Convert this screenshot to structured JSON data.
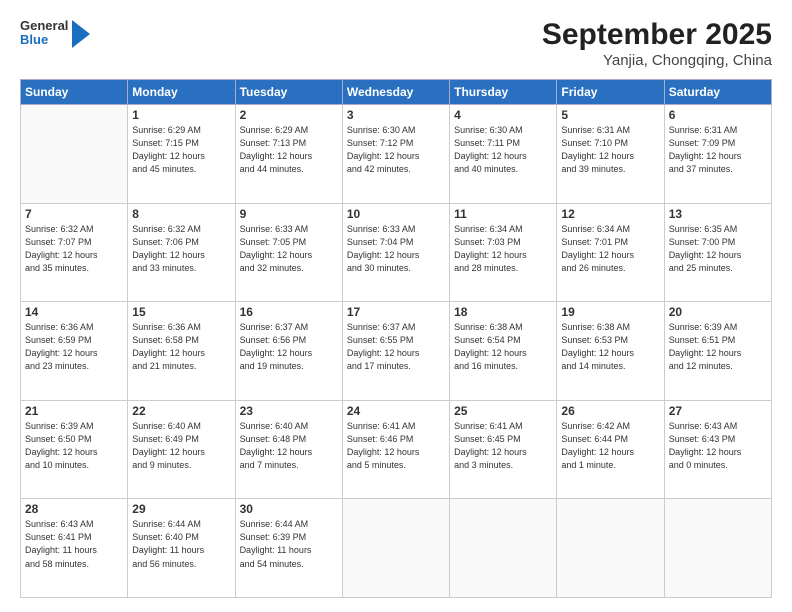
{
  "logo": {
    "general": "General",
    "blue": "Blue"
  },
  "header": {
    "month": "September 2025",
    "location": "Yanjia, Chongqing, China"
  },
  "weekdays": [
    "Sunday",
    "Monday",
    "Tuesday",
    "Wednesday",
    "Thursday",
    "Friday",
    "Saturday"
  ],
  "weeks": [
    [
      {
        "day": "",
        "info": ""
      },
      {
        "day": "1",
        "info": "Sunrise: 6:29 AM\nSunset: 7:15 PM\nDaylight: 12 hours\nand 45 minutes."
      },
      {
        "day": "2",
        "info": "Sunrise: 6:29 AM\nSunset: 7:13 PM\nDaylight: 12 hours\nand 44 minutes."
      },
      {
        "day": "3",
        "info": "Sunrise: 6:30 AM\nSunset: 7:12 PM\nDaylight: 12 hours\nand 42 minutes."
      },
      {
        "day": "4",
        "info": "Sunrise: 6:30 AM\nSunset: 7:11 PM\nDaylight: 12 hours\nand 40 minutes."
      },
      {
        "day": "5",
        "info": "Sunrise: 6:31 AM\nSunset: 7:10 PM\nDaylight: 12 hours\nand 39 minutes."
      },
      {
        "day": "6",
        "info": "Sunrise: 6:31 AM\nSunset: 7:09 PM\nDaylight: 12 hours\nand 37 minutes."
      }
    ],
    [
      {
        "day": "7",
        "info": "Sunrise: 6:32 AM\nSunset: 7:07 PM\nDaylight: 12 hours\nand 35 minutes."
      },
      {
        "day": "8",
        "info": "Sunrise: 6:32 AM\nSunset: 7:06 PM\nDaylight: 12 hours\nand 33 minutes."
      },
      {
        "day": "9",
        "info": "Sunrise: 6:33 AM\nSunset: 7:05 PM\nDaylight: 12 hours\nand 32 minutes."
      },
      {
        "day": "10",
        "info": "Sunrise: 6:33 AM\nSunset: 7:04 PM\nDaylight: 12 hours\nand 30 minutes."
      },
      {
        "day": "11",
        "info": "Sunrise: 6:34 AM\nSunset: 7:03 PM\nDaylight: 12 hours\nand 28 minutes."
      },
      {
        "day": "12",
        "info": "Sunrise: 6:34 AM\nSunset: 7:01 PM\nDaylight: 12 hours\nand 26 minutes."
      },
      {
        "day": "13",
        "info": "Sunrise: 6:35 AM\nSunset: 7:00 PM\nDaylight: 12 hours\nand 25 minutes."
      }
    ],
    [
      {
        "day": "14",
        "info": "Sunrise: 6:36 AM\nSunset: 6:59 PM\nDaylight: 12 hours\nand 23 minutes."
      },
      {
        "day": "15",
        "info": "Sunrise: 6:36 AM\nSunset: 6:58 PM\nDaylight: 12 hours\nand 21 minutes."
      },
      {
        "day": "16",
        "info": "Sunrise: 6:37 AM\nSunset: 6:56 PM\nDaylight: 12 hours\nand 19 minutes."
      },
      {
        "day": "17",
        "info": "Sunrise: 6:37 AM\nSunset: 6:55 PM\nDaylight: 12 hours\nand 17 minutes."
      },
      {
        "day": "18",
        "info": "Sunrise: 6:38 AM\nSunset: 6:54 PM\nDaylight: 12 hours\nand 16 minutes."
      },
      {
        "day": "19",
        "info": "Sunrise: 6:38 AM\nSunset: 6:53 PM\nDaylight: 12 hours\nand 14 minutes."
      },
      {
        "day": "20",
        "info": "Sunrise: 6:39 AM\nSunset: 6:51 PM\nDaylight: 12 hours\nand 12 minutes."
      }
    ],
    [
      {
        "day": "21",
        "info": "Sunrise: 6:39 AM\nSunset: 6:50 PM\nDaylight: 12 hours\nand 10 minutes."
      },
      {
        "day": "22",
        "info": "Sunrise: 6:40 AM\nSunset: 6:49 PM\nDaylight: 12 hours\nand 9 minutes."
      },
      {
        "day": "23",
        "info": "Sunrise: 6:40 AM\nSunset: 6:48 PM\nDaylight: 12 hours\nand 7 minutes."
      },
      {
        "day": "24",
        "info": "Sunrise: 6:41 AM\nSunset: 6:46 PM\nDaylight: 12 hours\nand 5 minutes."
      },
      {
        "day": "25",
        "info": "Sunrise: 6:41 AM\nSunset: 6:45 PM\nDaylight: 12 hours\nand 3 minutes."
      },
      {
        "day": "26",
        "info": "Sunrise: 6:42 AM\nSunset: 6:44 PM\nDaylight: 12 hours\nand 1 minute."
      },
      {
        "day": "27",
        "info": "Sunrise: 6:43 AM\nSunset: 6:43 PM\nDaylight: 12 hours\nand 0 minutes."
      }
    ],
    [
      {
        "day": "28",
        "info": "Sunrise: 6:43 AM\nSunset: 6:41 PM\nDaylight: 11 hours\nand 58 minutes."
      },
      {
        "day": "29",
        "info": "Sunrise: 6:44 AM\nSunset: 6:40 PM\nDaylight: 11 hours\nand 56 minutes."
      },
      {
        "day": "30",
        "info": "Sunrise: 6:44 AM\nSunset: 6:39 PM\nDaylight: 11 hours\nand 54 minutes."
      },
      {
        "day": "",
        "info": ""
      },
      {
        "day": "",
        "info": ""
      },
      {
        "day": "",
        "info": ""
      },
      {
        "day": "",
        "info": ""
      }
    ]
  ]
}
